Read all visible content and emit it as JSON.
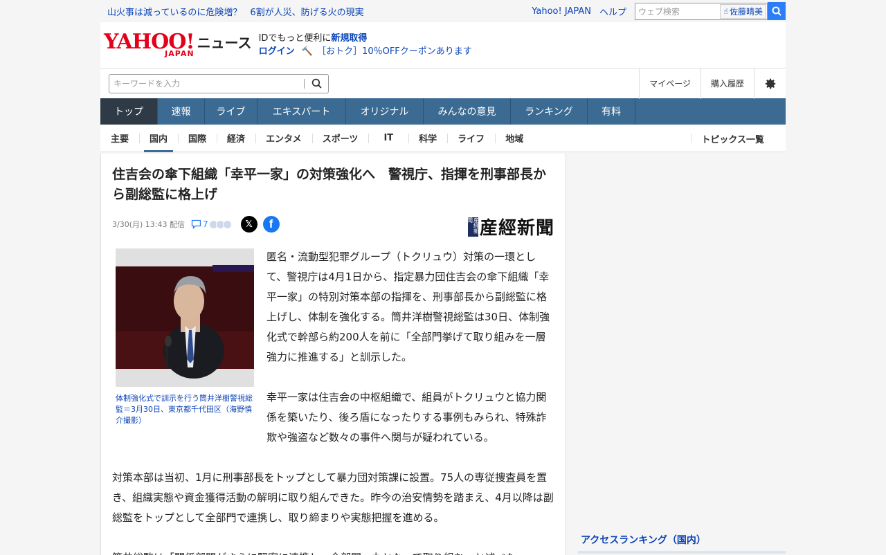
{
  "topbar": {
    "emergency_links": [
      "山火事は減っているのに危険増？",
      "6割が人災、防げる火の現実"
    ],
    "yahoo_japan": "Yahoo! JAPAN",
    "help": "ヘルプ",
    "web_search_placeholder": "ウェブ検索",
    "user_name": "佐藤晴美"
  },
  "header": {
    "logo_main": "YAHOO!",
    "logo_sub": "JAPAN",
    "logo_news": "ニュース",
    "promo_text": "IDでもっと便利に",
    "promo_signup": "新規取得",
    "promo_login": "ログイン",
    "promo_coupon": "［おトク］10％OFFクーポンあります"
  },
  "search": {
    "placeholder": "キーワードを入力",
    "mypage": "マイページ",
    "history": "購入履歴"
  },
  "global_nav": [
    {
      "label": "トップ",
      "active": true
    },
    {
      "label": "速報"
    },
    {
      "label": "ライブ"
    },
    {
      "label": "エキスパート"
    },
    {
      "label": "オリジナル"
    },
    {
      "label": "みんなの意見"
    },
    {
      "label": "ランキング"
    },
    {
      "label": "有料"
    }
  ],
  "sub_nav": [
    {
      "label": "主要"
    },
    {
      "label": "国内",
      "active": true
    },
    {
      "label": "国際"
    },
    {
      "label": "経済"
    },
    {
      "label": "エンタメ"
    },
    {
      "label": "スポーツ"
    },
    {
      "label": "IT"
    },
    {
      "label": "科学"
    },
    {
      "label": "ライフ"
    },
    {
      "label": "地域"
    }
  ],
  "sub_nav_topics": "トピックス一覧",
  "article": {
    "title": "住吉会の傘下組織「幸平一家」の対策強化へ　警視庁、指揮を刑事部長から副総監に格上げ",
    "date": "3/30(月) 13:43 配信",
    "comment_count": "7",
    "publisher": "産經新聞",
    "publisher_box": "産経新聞",
    "caption": "体制強化式で訓示を行う筒井洋樹警視総監＝3月30日、東京都千代田区（海野慎介撮影）",
    "paragraphs": [
      "匿名・流動型犯罪グループ（トクリュウ）対策の一環として、警視庁は4月1日から、指定暴力団住吉会の傘下組織「幸平一家」の特別対策本部の指揮を、刑事部長から副総監に格上げし、体制を強化する。筒井洋樹警視総監は30日、体制強化式で幹部ら約200人を前に「全部門挙げて取り組みを一層強力に推進する」と訓示した。",
      "幸平一家は住吉会の中枢組織で、組員がトクリュウと協力関係を築いたり、後ろ盾になったりする事例もみられ、特殊詐欺や強盗など数々の事件へ関与が疑われている。",
      "対策本部は当初、1月に刑事部長をトップとして暴力団対策課に設置。75人の専従捜査員を置き、組織実態や資金獲得活動の解明に取り組んできた。昨今の治安情勢を踏まえ、4月以降は副総監をトップとして全部門で連携し、取り締まりや実態把握を進める。",
      "筒井総監は「関係部門がさらに緊密に連携し、全部門一丸となって取り組む」と述べた。"
    ]
  },
  "sidebar": {
    "ranking_title": "アクセスランキング（国内）"
  },
  "colors": {
    "nav_bg": "#3b6a92",
    "nav_active": "#2e3b47",
    "link": "#0a44b8",
    "logo_red": "#e2001a"
  }
}
